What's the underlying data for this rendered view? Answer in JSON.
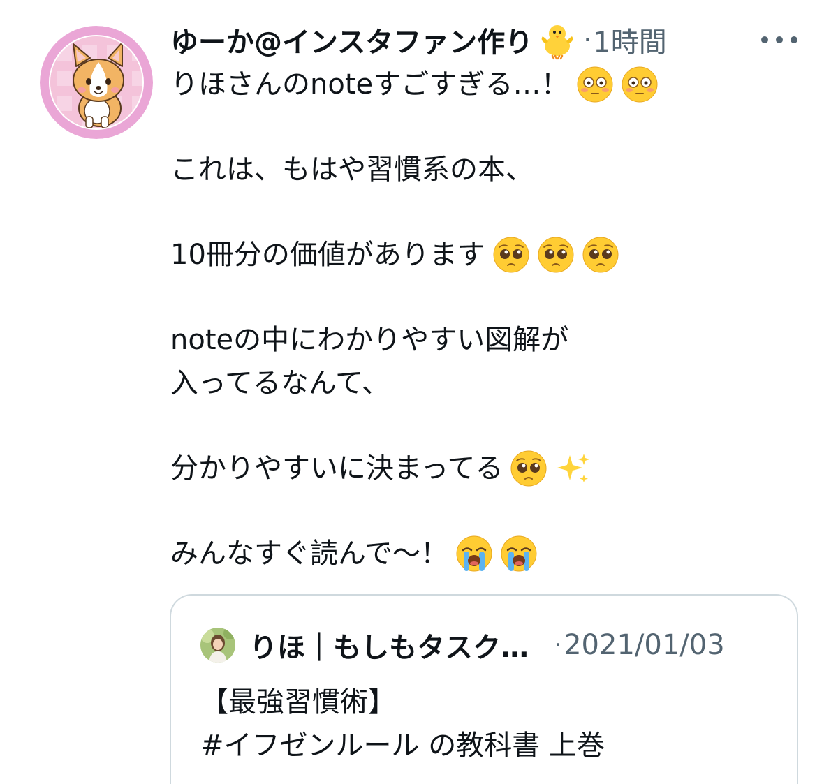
{
  "tweet": {
    "display_name": "ゆーか@インスタファン作り",
    "name_emoji": "baby-chick-icon",
    "dot": "·",
    "time": "1時間",
    "more_icon": "more-horizontal-icon",
    "lines": [
      {
        "text": "りほさんのnoteすごすぎる…！",
        "emojis": [
          "flushed-face-icon",
          "flushed-face-icon"
        ]
      },
      {
        "text": "これは、もはや習慣系の本、",
        "emojis": []
      },
      {
        "text": "10冊分の価値があります",
        "emojis": [
          "pleading-face-icon",
          "pleading-face-icon",
          "pleading-face-icon"
        ]
      },
      {
        "text": "noteの中にわかりやすい図解が",
        "emojis": []
      },
      {
        "text": "入ってるなんて、",
        "emojis": []
      },
      {
        "text": "分かりやすいに決まってる",
        "emojis": [
          "pleading-face-icon",
          "sparkles-icon"
        ]
      },
      {
        "text": "みんなすぐ読んで〜！",
        "emojis": [
          "loudly-crying-face-icon",
          "loudly-crying-face-icon"
        ]
      }
    ]
  },
  "quoted": {
    "display_name": "りほ｜もしもタスク…",
    "dot": "·",
    "date": "2021/01/03",
    "text_line1": "【最強習慣術】",
    "text_line2": "#イフゼンルール の教科書 上巻"
  },
  "colors": {
    "text": "#0f1419",
    "secondary": "#536471",
    "border": "#cfd9de",
    "avatar_ring": "#e9a3d3",
    "emoji_yellow": "#ffcc33"
  }
}
